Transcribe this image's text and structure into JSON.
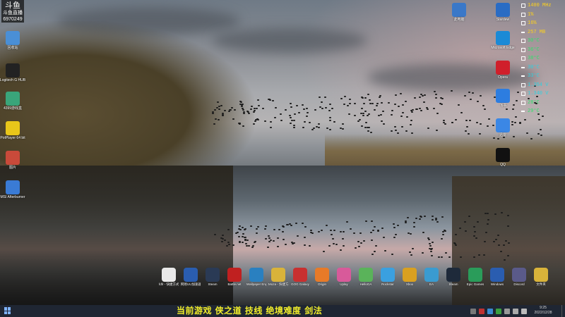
{
  "desktop": {
    "logo": {
      "line1": "斗鱼",
      "line2": "斗鱼直播",
      "line3": "6970249"
    },
    "left_icons": [
      {
        "label": "回收站",
        "icon": "recycle-bin-icon",
        "color": "#4a8fd6"
      },
      {
        "label": "Logitech G HUB",
        "icon": "logitech-icon",
        "color": "#222222"
      },
      {
        "label": "4399游戏盒",
        "icon": "game-box-icon",
        "color": "#3aa57a"
      },
      {
        "label": "PotPlayer 64 bit",
        "icon": "potplayer-icon",
        "color": "#e8c61a"
      },
      {
        "label": "图片",
        "icon": "images-icon",
        "color": "#c94a3a"
      },
      {
        "label": "MSI Afterburner",
        "icon": "afterburner-icon",
        "color": "#3a7bd5"
      }
    ],
    "right_icons": [
      {
        "label": "此电脑",
        "icon": "computer-icon",
        "color": "#3a78c8"
      },
      {
        "label": "Stardew",
        "icon": "stardew-icon",
        "color": "#2a6cc4"
      },
      {
        "label": "Microsoft Edge",
        "icon": "edge-icon",
        "color": "#1b8ad6"
      },
      {
        "label": "Opera",
        "icon": "opera-icon",
        "color": "#d01f2b"
      },
      {
        "label": "飞书",
        "icon": "feishu-icon",
        "color": "#2d7de0"
      },
      {
        "label": "迅雷",
        "icon": "thunder-icon",
        "color": "#3b87e5"
      },
      {
        "label": "QQ",
        "icon": "qq-icon",
        "color": "#111111"
      }
    ],
    "dock": [
      {
        "label": "fdfr - 快捷方式",
        "icon": "grid-icon",
        "color": "#e9e9e9"
      },
      {
        "label": "网易UU加速器",
        "icon": "uu-icon",
        "color": "#2a5db0"
      },
      {
        "label": "Steam",
        "icon": "steam-icon",
        "color": "#2a3a55"
      },
      {
        "label": "Battle.net",
        "icon": "bnet-icon",
        "color": "#c02020"
      },
      {
        "label": "Wallpaper Engine",
        "icon": "wallpaper-icon",
        "color": "#2a80c0"
      },
      {
        "label": "Moza - 快捷方式",
        "icon": "moza-icon",
        "color": "#d9b33a"
      },
      {
        "label": "GOG Galaxy",
        "icon": "gog-icon",
        "color": "#c83030"
      },
      {
        "label": "Origin",
        "icon": "origin-icon",
        "color": "#e77a28"
      },
      {
        "label": "Uplay",
        "icon": "uplay-icon",
        "color": "#d85a9a"
      },
      {
        "label": "HelloGA",
        "icon": "helloga-icon",
        "color": "#5ab35a"
      },
      {
        "label": "Rockstar",
        "icon": "rockstar-icon",
        "color": "#3aa0e0"
      },
      {
        "label": "Xbox",
        "icon": "xbox-icon",
        "color": "#d9a020"
      },
      {
        "label": "EA",
        "icon": "ea-icon",
        "color": "#3a9bd0"
      },
      {
        "label": "Steam",
        "icon": "steam-icon",
        "color": "#1e2a3a"
      },
      {
        "label": "Epic Games",
        "icon": "epic-icon",
        "color": "#2a9c5a"
      },
      {
        "label": "Windows",
        "icon": "windows-icon",
        "color": "#2a5db0"
      },
      {
        "label": "Discord",
        "icon": "discord-icon",
        "color": "#5a5a8a"
      },
      {
        "label": "文件夹",
        "icon": "folder-icon",
        "color": "#d9b33a"
      }
    ]
  },
  "hw_monitor": {
    "rows": [
      {
        "text": "1400 MHz",
        "color": "#ffd21a",
        "marker": "box"
      },
      {
        "text": "1%",
        "color": "#ffd21a",
        "marker": "box"
      },
      {
        "text": "16%",
        "color": "#ffd21a",
        "marker": "box"
      },
      {
        "text": "257 MB",
        "color": "#ffd21a",
        "marker": "dash"
      },
      {
        "text": "30°C",
        "color": "#2ee06a",
        "marker": "box"
      },
      {
        "text": "36°C",
        "color": "#2ee06a",
        "marker": "box"
      },
      {
        "text": "38°C",
        "color": "#2ee06a",
        "marker": "box"
      },
      {
        "text": "30°C",
        "color": "#2ed1e0",
        "marker": "dash"
      },
      {
        "text": "33°C",
        "color": "#2ed1e0",
        "marker": "dash"
      },
      {
        "text": "1.354 V",
        "color": "#2ed1e0",
        "marker": "box"
      },
      {
        "text": "1.340 V",
        "color": "#2ed1e0",
        "marker": "box"
      },
      {
        "text": "28°C",
        "color": "#2ee06a",
        "marker": "box"
      },
      {
        "text": "29°C",
        "color": "#2ee06a",
        "marker": "dash"
      }
    ]
  },
  "taskbar": {
    "caption": "当前游戏 侠之道 技线 绝境难度 剑法",
    "clock_time": "9:25",
    "clock_date": "2022/12/28"
  }
}
